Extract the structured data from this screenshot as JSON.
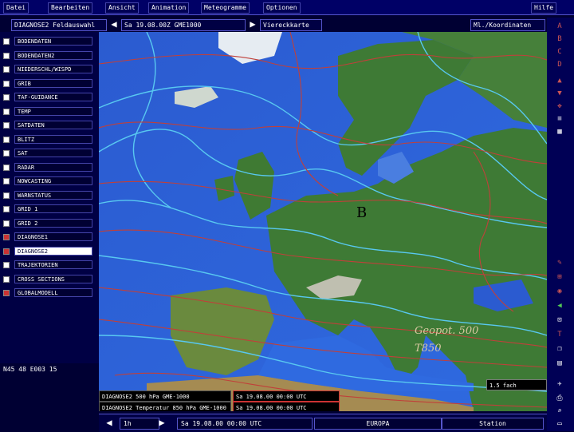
{
  "menu": {
    "items": [
      "Datei",
      "Bearbeiten",
      "Ansicht",
      "Animation",
      "Meteogramme",
      "Optionen"
    ],
    "help": "Hilfe"
  },
  "toolbar": {
    "region_select": "DIAGNOSE2 Feldauswahl",
    "datetime": "Sa 19.08.00Z GME1000",
    "view": "Viereckkarte",
    "coords_toggle": "Ml./Koordinaten"
  },
  "layers": [
    {
      "label": "BODENDATEN",
      "checked": false,
      "selected": false
    },
    {
      "label": "BODENDATEN2",
      "checked": false,
      "selected": false
    },
    {
      "label": "NIEDERSCHL/WISPD",
      "checked": false,
      "selected": false
    },
    {
      "label": "GRIB",
      "checked": false,
      "selected": false
    },
    {
      "label": "TAF-GUIDANCE",
      "checked": false,
      "selected": false
    },
    {
      "label": "TEMP",
      "checked": false,
      "selected": false
    },
    {
      "label": "SATDATEN",
      "checked": false,
      "selected": false
    },
    {
      "label": "BLITZ",
      "checked": false,
      "selected": false
    },
    {
      "label": "SAT",
      "checked": false,
      "selected": false
    },
    {
      "label": "RADAR",
      "checked": false,
      "selected": false
    },
    {
      "label": "NOWCASTING",
      "checked": false,
      "selected": false
    },
    {
      "label": "WARNSTATUS",
      "checked": false,
      "selected": false
    },
    {
      "label": "GRID 1",
      "checked": false,
      "selected": false
    },
    {
      "label": "GRID 2",
      "checked": false,
      "selected": false
    },
    {
      "label": "DIAGNOSE1",
      "checked": true,
      "selected": false
    },
    {
      "label": "DIAGNOSE2",
      "checked": true,
      "selected": true
    },
    {
      "label": "TRAJEKTORIEN",
      "checked": false,
      "selected": false
    },
    {
      "label": "CROSS SECTIONS",
      "checked": false,
      "selected": false
    },
    {
      "label": "GLOBALMODELL",
      "checked": true,
      "selected": false
    }
  ],
  "cursor_position": "N45 48 E003 15",
  "map": {
    "labels": {
      "geopot": "Geopot. 500",
      "temp": "T850",
      "low_center": "B"
    },
    "level_box": "1.5 fach",
    "colors": {
      "sea": "#2f63d8",
      "land_green": "#3e7a35",
      "geopotential": "#58c8f0",
      "temperature": "#c0403a"
    }
  },
  "legend": {
    "row1_field": "DIAGNOSE2 500 hPa GME-1000",
    "row1_time": "Sa 19.08.00 00:00 UTC",
    "row2_field": "DIAGNOSE2 Temperatur 850 hPa GME-1000",
    "row2_time": "Sa 19.08.00 00:00 UTC"
  },
  "bottom": {
    "step": "1h",
    "time": "Sa 19.08.00 00:00 UTC",
    "region": "EUROPA",
    "station": "Station"
  },
  "rightbar": {
    "top_letters": [
      "A",
      "B",
      "C",
      "D"
    ]
  }
}
